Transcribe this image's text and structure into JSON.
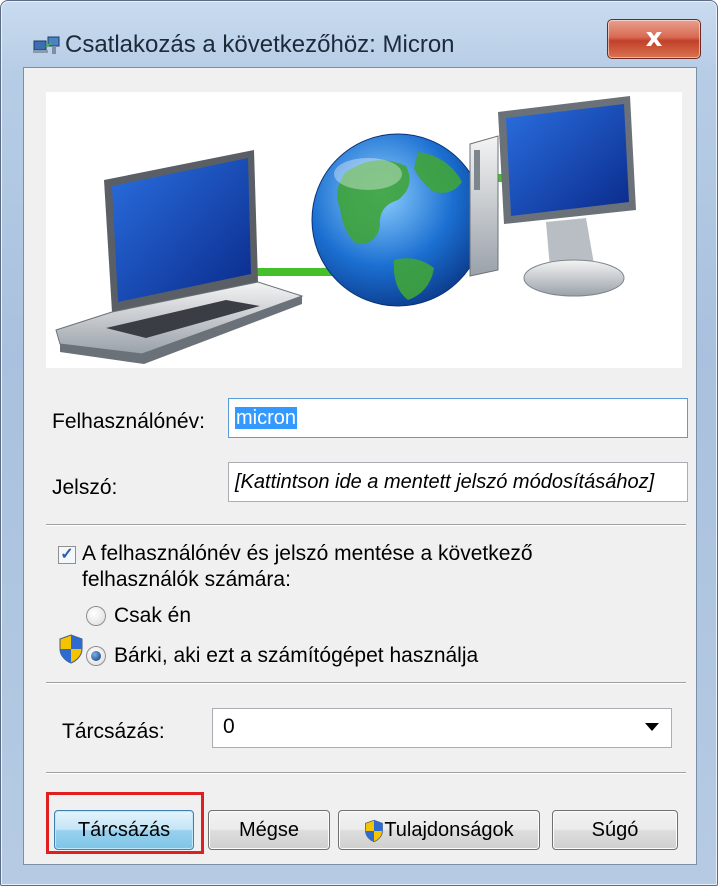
{
  "window": {
    "title": "Csatlakozás a következőhöz: Micron",
    "close_label": "x"
  },
  "form": {
    "username_label": "Felhasználónév:",
    "username_value": "micron",
    "password_label": "Jelszó:",
    "password_hint": "[Kattintson ide a mentett jelszó módosításához]",
    "save_credentials_line1": "A felhasználónév és jelszó mentése a következő",
    "save_credentials_line2": "felhasználók számára:",
    "save_credentials_checked": true,
    "option_only_me": "Csak én",
    "option_anyone": "Bárki, aki ezt a számítógépet használja",
    "selected_option": "anyone",
    "dial_label": "Tárcsázás:",
    "dial_value": "0"
  },
  "buttons": {
    "dial": "Tárcsázás",
    "cancel": "Mégse",
    "properties": "Tulajdonságok",
    "help": "Súgó"
  },
  "colors": {
    "highlight": "#e02020",
    "selection": "#3399ff",
    "close": "#c2402a"
  }
}
